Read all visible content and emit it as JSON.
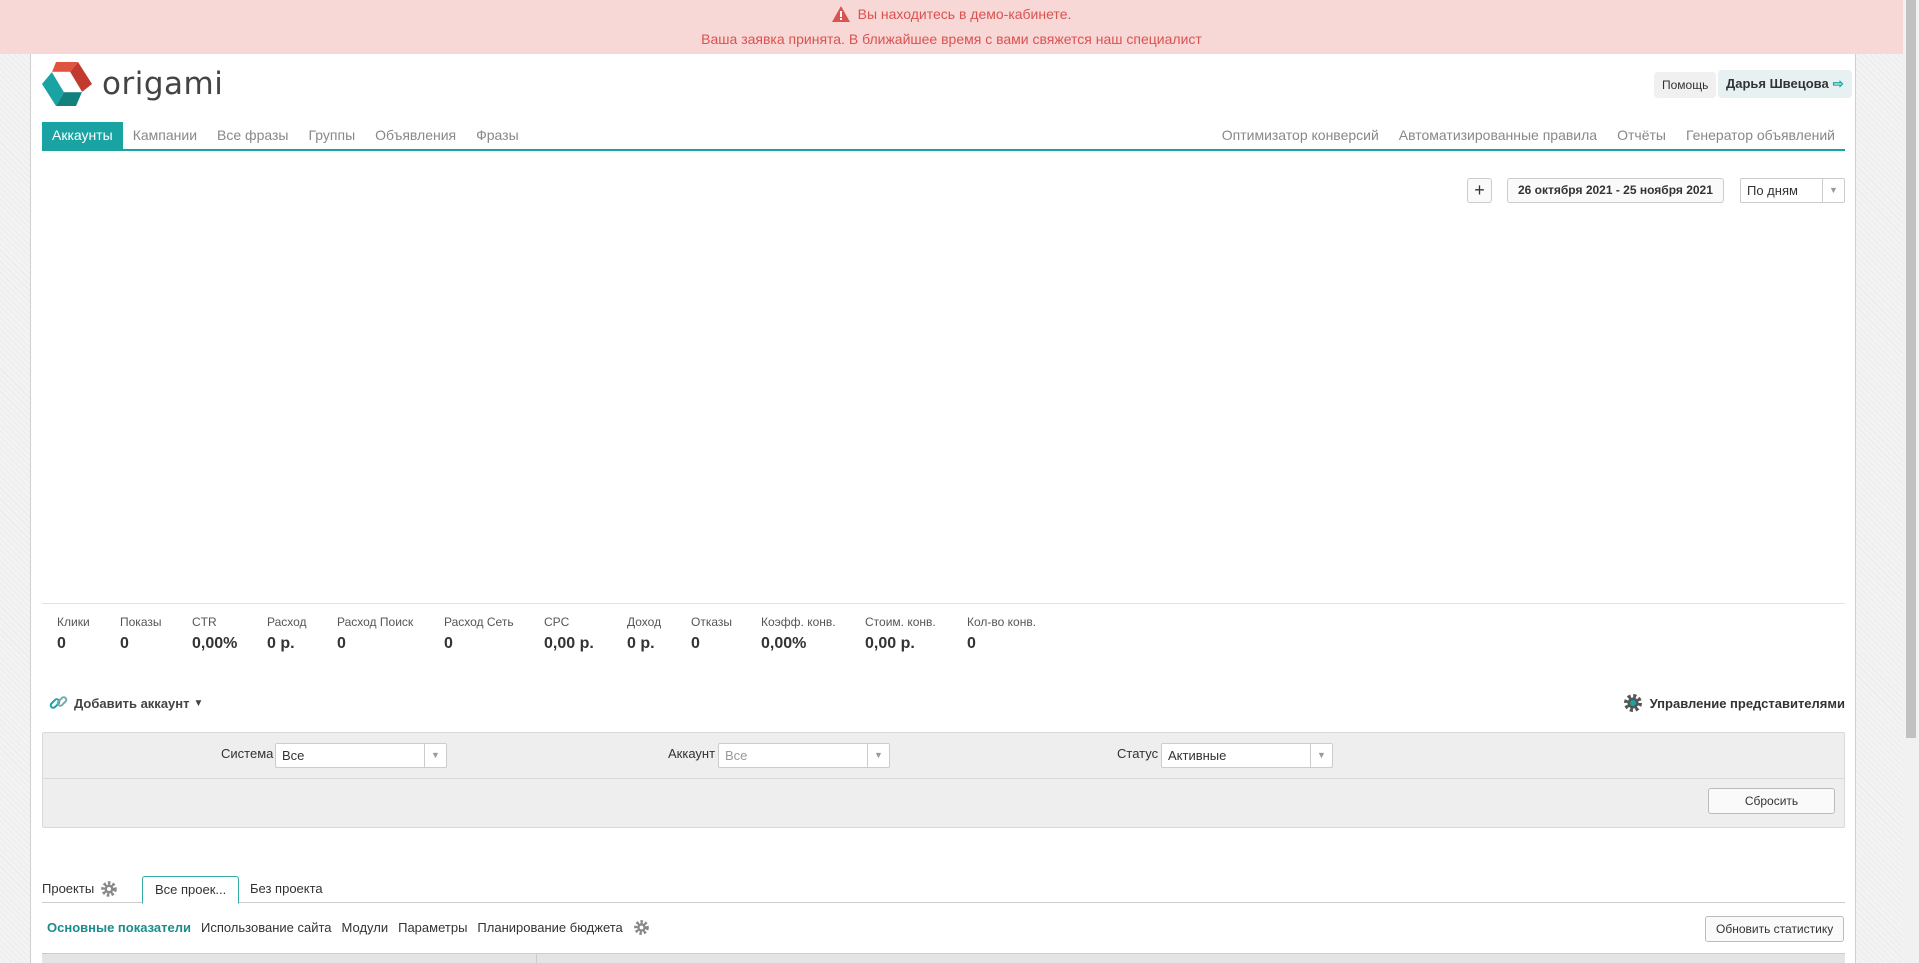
{
  "banner": {
    "warning": "Вы находитесь в демо-кабинете.",
    "message": "Ваша заявка принята. В ближайшее время с вами свяжется наш специалист",
    "color": "#d9534f",
    "background": "#f8d7d7"
  },
  "header": {
    "logo_text": "origami",
    "help_label": "Помощь",
    "user_name": "Дарья Швецова",
    "user_icon": "sign-out-icon"
  },
  "nav": {
    "left": [
      {
        "label": "Аккаунты",
        "active": true
      },
      {
        "label": "Кампании"
      },
      {
        "label": "Все фразы"
      },
      {
        "label": "Группы"
      },
      {
        "label": "Объявления"
      },
      {
        "label": "Фразы"
      }
    ],
    "right": [
      {
        "label": "Оптимизатор конверсий"
      },
      {
        "label": "Автоматизированные правила"
      },
      {
        "label": "Отчёты"
      },
      {
        "label": "Генератор объявлений"
      }
    ],
    "accent": "#1aa3a3"
  },
  "toolbar": {
    "plus_label": "+",
    "date_range": "26 октября 2021 - 25 ноября 2021",
    "period": "По дням"
  },
  "stats": [
    {
      "label": "Клики",
      "value": "0"
    },
    {
      "label": "Показы",
      "value": "0"
    },
    {
      "label": "CTR",
      "value": "0,00%"
    },
    {
      "label": "Расход",
      "value": "0 р."
    },
    {
      "label": "Расход Поиск",
      "value": "0"
    },
    {
      "label": "Расход Сеть",
      "value": "0"
    },
    {
      "label": "CPC",
      "value": "0,00 р."
    },
    {
      "label": "Доход",
      "value": "0 р."
    },
    {
      "label": "Отказы",
      "value": "0"
    },
    {
      "label": "Коэфф. конв.",
      "value": "0,00%"
    },
    {
      "label": "Стоим. конв.",
      "value": "0,00 р."
    },
    {
      "label": "Кол-во конв.",
      "value": "0"
    }
  ],
  "actions": {
    "add_account": "Добавить аккаунт",
    "manage_reps": "Управление представителями"
  },
  "filters": {
    "system_label": "Система",
    "system_value": "Все",
    "account_label": "Аккаунт",
    "account_value": "Все",
    "status_label": "Статус",
    "status_value": "Активные",
    "reset_label": "Сбросить"
  },
  "projects": {
    "label": "Проекты",
    "tabs": [
      {
        "label": "Все проек...",
        "active": true
      },
      {
        "label": "Без проекта"
      }
    ]
  },
  "subtabs": {
    "items": [
      {
        "label": "Основные показатели",
        "active": true
      },
      {
        "label": "Использование сайта"
      },
      {
        "label": "Модули"
      },
      {
        "label": "Параметры"
      },
      {
        "label": "Планирование бюджета"
      }
    ],
    "refresh_label": "Обновить статистику"
  }
}
